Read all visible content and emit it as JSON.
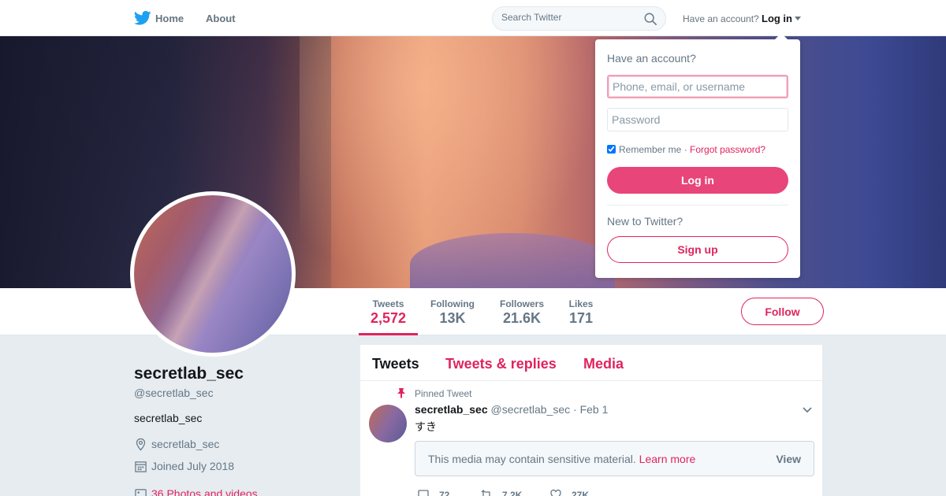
{
  "nav": {
    "home_label": "Home",
    "about_label": "About",
    "search_placeholder": "Search Twitter",
    "have_account_text": "Have an account?",
    "login_label": "Log in",
    "brand_color": "#1da1f2",
    "logo_icon": "twitter-bird-icon"
  },
  "profile": {
    "display_name": "secretlab_sec",
    "handle": "@secretlab_sec",
    "bio": "secretlab_sec",
    "location": "secretlab_sec",
    "joined": "Joined July 2018",
    "photos": "36 Photos and videos",
    "accent_color": "#e0245e"
  },
  "stats": [
    {
      "label": "Tweets",
      "value": "2,572",
      "active": true
    },
    {
      "label": "Following",
      "value": "13K",
      "active": false
    },
    {
      "label": "Followers",
      "value": "21.6K",
      "active": false
    },
    {
      "label": "Likes",
      "value": "171",
      "active": false
    }
  ],
  "follow_label": "Follow",
  "timeline": {
    "tabs": [
      "Tweets",
      "Tweets & replies",
      "Media"
    ],
    "active_tab": "Tweets",
    "pinned_label": "Pinned Tweet",
    "tweet": {
      "name": "secretlab_sec",
      "handle": "@secretlab_sec",
      "separator": "·",
      "date": "Feb 1",
      "text": "すき",
      "sensitive_message": "This media may contain sensitive material.",
      "learn_more": "Learn more",
      "view_label": "View",
      "replies": "72",
      "retweets": "7.2K",
      "likes": "27K"
    }
  },
  "login_dropdown": {
    "title": "Have an account?",
    "username_placeholder": "Phone, email, or username",
    "password_placeholder": "Password",
    "remember_label": "Remember me",
    "separator": "·",
    "forgot_label": "Forgot password?",
    "login_button": "Log in",
    "new_text": "New to Twitter?",
    "signup_button": "Sign up",
    "remember_checked": true
  }
}
